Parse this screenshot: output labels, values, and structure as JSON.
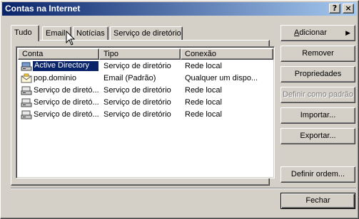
{
  "window": {
    "title": "Contas na Internet",
    "help_label": "?",
    "close_label": "×"
  },
  "tabs": [
    {
      "label": "Tudo",
      "active": true
    },
    {
      "label": "Email",
      "active": false
    },
    {
      "label": "Notícias",
      "active": false
    },
    {
      "label": "Serviço de diretório",
      "active": false
    }
  ],
  "list": {
    "columns": [
      "Conta",
      "Tipo",
      "Conexão"
    ],
    "rows": [
      {
        "conta": "Active Directory",
        "tipo": "Serviço de diretório",
        "conexao": "Rede local",
        "icon": "directory-service-icon",
        "selected": true
      },
      {
        "conta": "pop.dominio",
        "tipo": "Email (Padrão)",
        "conexao": "Qualquer um dispo...",
        "icon": "mail-account-icon",
        "selected": false
      },
      {
        "conta": "Serviço de diretó...",
        "tipo": "Serviço de diretório",
        "conexao": "Rede local",
        "icon": "directory-service-icon",
        "selected": false
      },
      {
        "conta": "Serviço de diretó...",
        "tipo": "Serviço de diretório",
        "conexao": "Rede local",
        "icon": "directory-service-icon",
        "selected": false
      },
      {
        "conta": "Serviço de diretó...",
        "tipo": "Serviço de diretório",
        "conexao": "Rede local",
        "icon": "directory-service-icon",
        "selected": false
      }
    ]
  },
  "buttons": {
    "adicionar": "Adicionar",
    "adicionar_arrow": "▶",
    "remover": "Remover",
    "propriedades": "Propriedades",
    "definir_padrao": "Definir como padrão",
    "importar": "Importar...",
    "exportar": "Exportar...",
    "definir_ordem": "Definir ordem...",
    "fechar": "Fechar"
  },
  "colors": {
    "face": "#d4d0c8",
    "title_start": "#0a246a",
    "title_end": "#a6caf0",
    "selection": "#0a246a"
  }
}
